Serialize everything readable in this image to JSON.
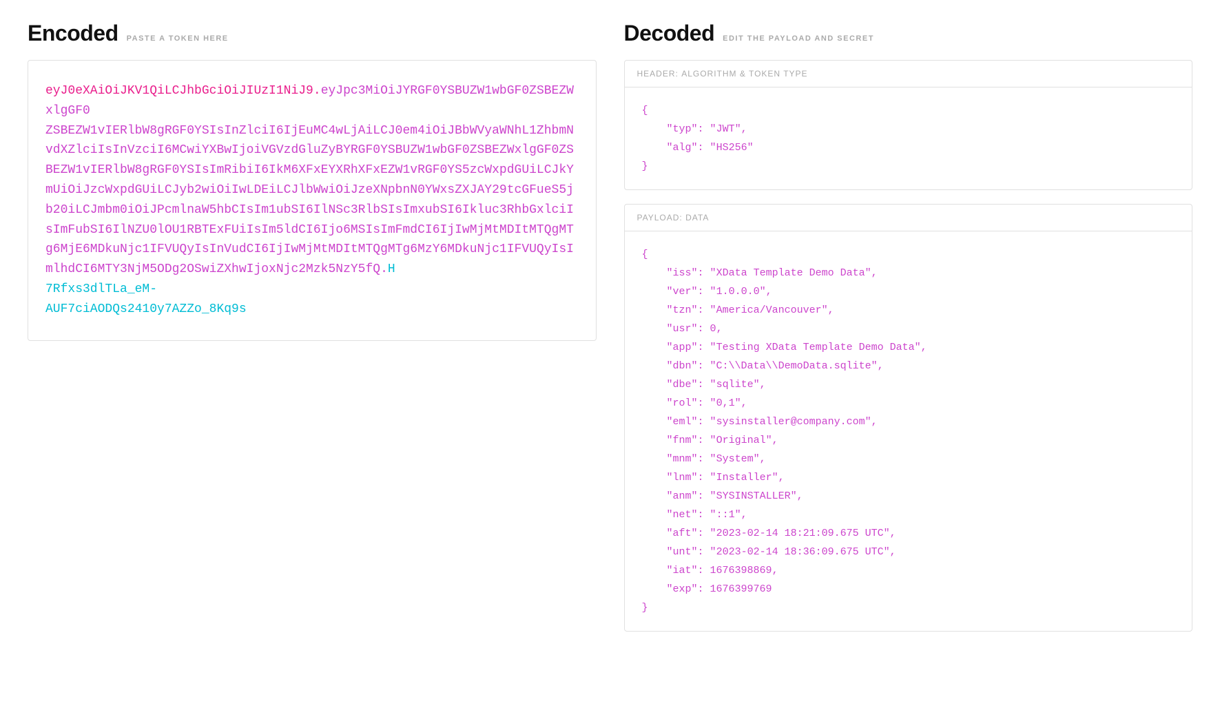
{
  "encoded": {
    "title": "Encoded",
    "subtitle": "PASTE A TOKEN HERE",
    "token": {
      "header_part": "eyJ0eXAiOiJKV1QiLCJhbGciOiJIUzI1NiJ9.",
      "payload_part": "eyJpc3MiOiJYRGF0YSBUZW1wbGF0ZSBEZWxlgGF0ZSBEZW1vIERlbW8gRGF0YSIsInZlciI6IjEuMC4wLjAiLCJ0em4iOiJBbWVyaWNhL1ZhbmNvdXZlciIsInVzciI6MCwiYXBwIjoiVGVzdGluZyBYRGF0YSBUZW1wbGF0ZSBEZWxlgGF0ZSBEZW1vIERlbW8gRGF0YSIsImRibiI6IkM6XFxEYXRhXFxEZW1vRGF0YS5zcWxpdGUiLCJkYmUiOiJzcWxpdGUiLCJyb2wiOiIwLDEiLCJlbWwiOiJzeXNpbnN0YWxsZXJAY29tcGFueS5jb20iLCJmbm0iOiJPcmlnaW5hbCIsIm1ubSI6IlNSc3RlbSIsImxubSI6Ikluc3RhbGxlciIsImFubSI6IlNZU0lOU1RBTExFUiIsIm5ldCI6Ijo6MSIsImFmdCI6IjIwMjMtMDItMTQgMTg6MjE6MDkuNjc1IFVUQyIsInVudCI6IjIwMjMtMDItMTQgMTg6MzY6MDkuNjc1IFVUQyIsImlhdCI6MTY3NjM5ODg2OSwiZXhwIjoxNjc2Mzk5NzY5fQ.",
      "signature_part": "H7Rfxs3dlTLa_eM-AUF7ciAODQs2410y7AZZo_8Kq9s"
    },
    "token_lines": {
      "header_segment": "eyJ0eXAiOiJKV1QiLCJhbGciOiJIUzI1NiJ9.ey",
      "line2": "Jpc3MiOiJYRGF0YSBUZW1wbGF0ZSBEZWxlgGF0ZSBEZW1vIERlbW8gRGF0YSIsInZlciI6IjEuMC4wLjAiLCJ0em4iOiJBbWVyaWNhL1ZhbmNvdXZlciIsInVzciI6MCwiYXBwIjoiVGVzdGluZyBYRGF0YSBUZW1wbGF0ZSBEZWxlgGF0ZSBEZW1vIERlbW8gRGF0YSIsImRibiI6IkM6XFxEYXRhXFxEZW1vRGF0YS5zcWxpdGUiLCJkYmUiOiJzcWxpdGUiLCJyb2wiOiIwLDEiLCJlbWwiOiJzeXNpbnN0YWxsZXJAY29tcGFueS5jb20iLCJmbm0iOiJPcmlnaW5hbCIsIm1ubSI6IlNSc3RlbSIsImxubSI6Ikluc3RhbGxlciIsImFubSI6IlNZU0lOU1RBTExFUiIsIm5ldCI6Ijo6MSIsImFmdCI6IjIwMjMtMDItMTQgMTg6MjE6MDkuNjc1IFVUQyIsInVudCI6IjIwMjMtMDItMTQgMTg6MzY6MDkuNjc1IFVUQyIsImlhdCI6MTY3NjM5ODg2OSwiZXhwIjoxNjc2Mzk5NzY5fQ.H7Rfxs3dlTLa_eM-AUF7ciAODQs2410y7AZZo_8Kq9s"
    }
  },
  "decoded": {
    "title": "Decoded",
    "subtitle": "EDIT THE PAYLOAD AND SECRET",
    "header": {
      "section_label": "HEADER:",
      "section_sublabel": "ALGORITHM & TOKEN TYPE",
      "typ": "JWT",
      "alg": "HS256"
    },
    "payload": {
      "section_label": "PAYLOAD:",
      "section_sublabel": "DATA",
      "iss": "XData Template Demo Data",
      "ver": "1.0.0.0",
      "tzn": "America/Vancouver",
      "usr": 0,
      "app": "Testing XData Template Demo Data",
      "dbn": "C:\\\\Data\\\\DemoData.sqlite",
      "dbe": "sqlite",
      "rol": "0,1",
      "eml": "sysinstaller@company.com",
      "fnm": "Original",
      "mnm": "System",
      "lnm": "Installer",
      "anm": "SYSINSTALLER",
      "net": "::1",
      "aft": "2023-02-14 18:21:09.675 UTC",
      "unt": "2023-02-14 18:36:09.675 UTC",
      "iat": 1676398869,
      "exp": 1676399769
    }
  }
}
